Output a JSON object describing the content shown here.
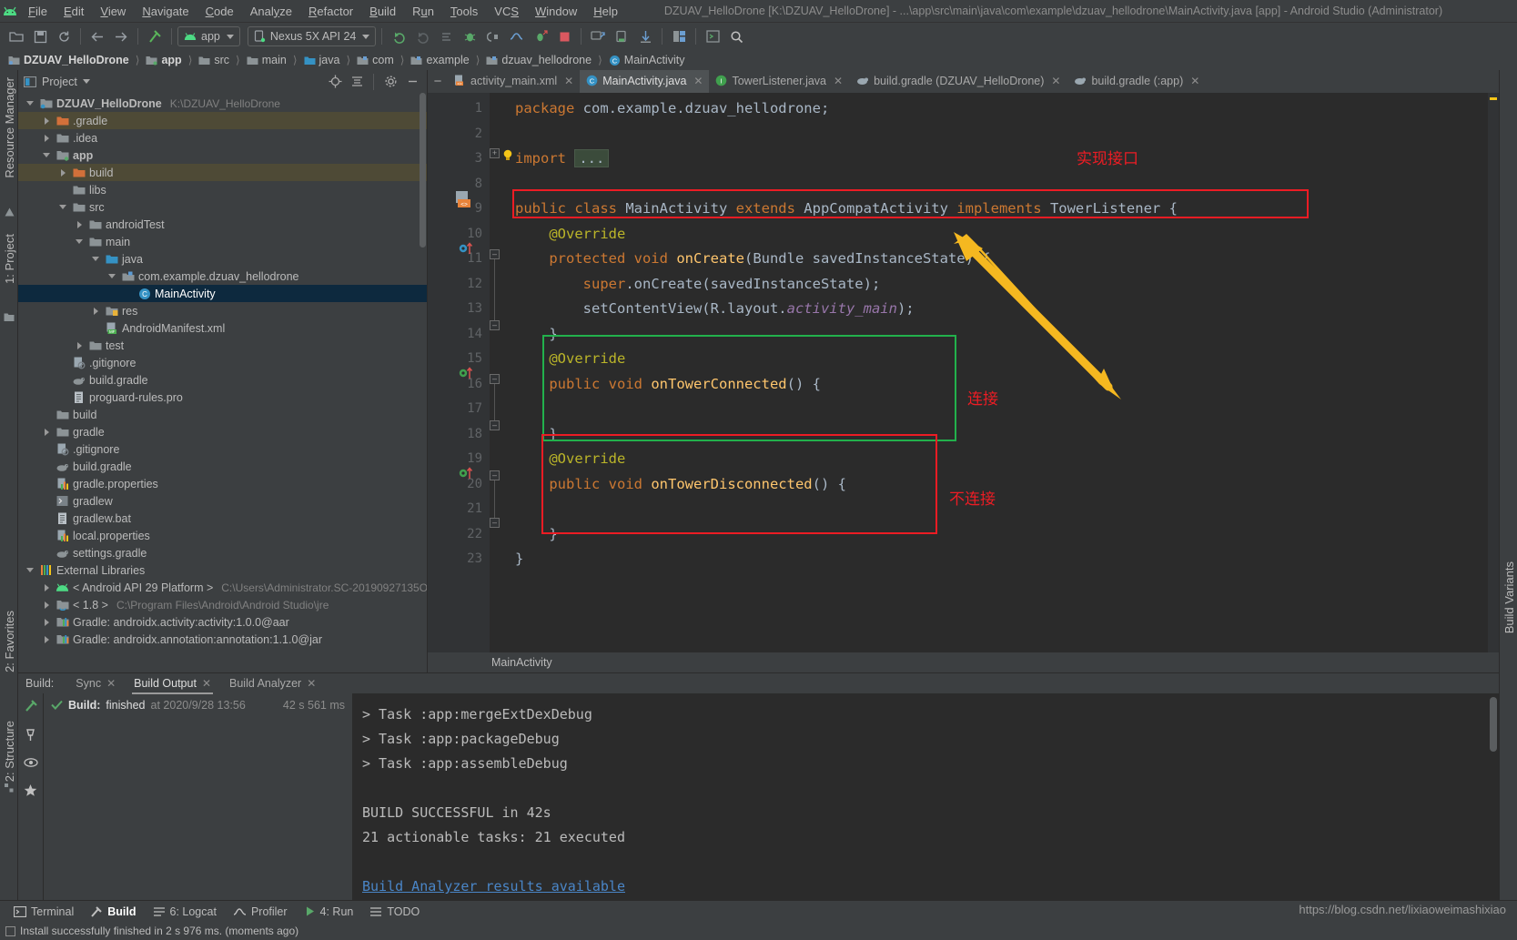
{
  "window": {
    "title": "DZUAV_HelloDrone [K:\\DZUAV_HelloDrone] - ...\\app\\src\\main\\java\\com\\example\\dzuav_hellodrone\\MainActivity.java [app] - Android Studio (Administrator)",
    "logo_icon": "android-logo-icon"
  },
  "menubar": [
    {
      "label": "File",
      "mnemonic": "F"
    },
    {
      "label": "Edit",
      "mnemonic": "E"
    },
    {
      "label": "View",
      "mnemonic": "V"
    },
    {
      "label": "Navigate",
      "mnemonic": "N"
    },
    {
      "label": "Code",
      "mnemonic": "C"
    },
    {
      "label": "Analyze",
      "mnemonic": "y"
    },
    {
      "label": "Refactor",
      "mnemonic": "R"
    },
    {
      "label": "Build",
      "mnemonic": "B"
    },
    {
      "label": "Run",
      "mnemonic": "u"
    },
    {
      "label": "Tools",
      "mnemonic": "T"
    },
    {
      "label": "VCS",
      "mnemonic": "S"
    },
    {
      "label": "Window",
      "mnemonic": "W"
    },
    {
      "label": "Help",
      "mnemonic": "H"
    }
  ],
  "toolbar": {
    "open_icon": "open-folder-icon",
    "save_icon": "save-icon",
    "sync_icon": "sync-icon",
    "back_icon": "arrow-left-icon",
    "forward_icon": "arrow-right-icon",
    "build_icon": "hammer-icon",
    "run_config": {
      "label": "app",
      "icon": "android-app-icon"
    },
    "device": {
      "label": "Nexus 5X API 24",
      "icon": "device-icon"
    },
    "run_icon": "run-icon",
    "rerun_icon": "rerun-icon",
    "apply_changes_icon": "apply-changes-icon",
    "debug_icon": "debug-icon",
    "attach_debugger_icon": "attach-debugger-icon",
    "profile_icon": "profiler-icon",
    "run_coverage_icon": "run-coverage-icon",
    "stop_icon": "stop-icon",
    "avd_manager_icon": "avd-manager-icon",
    "sdk_manager_icon": "sdk-manager-icon",
    "sync_gradle_icon": "sync-gradle-icon",
    "layout_inspector_icon": "layout-inspector-icon",
    "device_file_explorer_icon": "device-file-explorer-icon",
    "search_icon": "search-icon"
  },
  "breadcrumb": [
    {
      "label": "DZUAV_HelloDrone",
      "icon": "module-icon",
      "bold": true
    },
    {
      "label": "app",
      "icon": "app-module-icon",
      "bold": true
    },
    {
      "label": "src",
      "icon": "folder-icon",
      "bold": false
    },
    {
      "label": "main",
      "icon": "folder-icon",
      "bold": false
    },
    {
      "label": "java",
      "icon": "java-folder-icon",
      "bold": false
    },
    {
      "label": "com",
      "icon": "package-icon",
      "bold": false
    },
    {
      "label": "example",
      "icon": "package-icon",
      "bold": false
    },
    {
      "label": "dzuav_hellodrone",
      "icon": "package-icon",
      "bold": false
    },
    {
      "label": "MainActivity",
      "icon": "class-icon",
      "bold": false
    }
  ],
  "left_rail": [
    {
      "label": "Resource Manager",
      "icon": "resource-manager-icon"
    },
    {
      "label": "1: Project",
      "icon": "project-icon"
    }
  ],
  "left_rail_bottom": [
    {
      "label": "2: Favorites",
      "icon": "favorites-icon"
    },
    {
      "label": "2: Structure",
      "icon": "structure-icon"
    }
  ],
  "right_rail": [
    {
      "label": "Build Variants",
      "icon": "build-variants-icon"
    }
  ],
  "project_panel": {
    "title": "Project",
    "locate_icon": "locate-icon",
    "collapse_icon": "collapse-all-icon",
    "settings_icon": "gear-icon",
    "hide_icon": "hide-icon",
    "tree": [
      {
        "indent": 0,
        "arrow": "down",
        "icon": "module-icon",
        "label": "DZUAV_HelloDrone",
        "bold": true,
        "path": "K:\\DZUAV_HelloDrone",
        "state": "normal"
      },
      {
        "indent": 1,
        "arrow": "right",
        "icon": "folder-orange-icon",
        "label": ".gradle",
        "bold": false,
        "path": "",
        "state": "hl"
      },
      {
        "indent": 1,
        "arrow": "right",
        "icon": "folder-icon",
        "label": ".idea",
        "bold": false,
        "path": "",
        "state": "normal"
      },
      {
        "indent": 1,
        "arrow": "down",
        "icon": "app-module-icon",
        "label": "app",
        "bold": true,
        "path": "",
        "state": "normal"
      },
      {
        "indent": 2,
        "arrow": "right",
        "icon": "folder-orange-icon",
        "label": "build",
        "bold": false,
        "path": "",
        "state": "hl"
      },
      {
        "indent": 2,
        "arrow": "none",
        "icon": "folder-icon",
        "label": "libs",
        "bold": false,
        "path": "",
        "state": "normal"
      },
      {
        "indent": 2,
        "arrow": "down",
        "icon": "folder-icon",
        "label": "src",
        "bold": false,
        "path": "",
        "state": "normal"
      },
      {
        "indent": 3,
        "arrow": "right",
        "icon": "folder-icon",
        "label": "androidTest",
        "bold": false,
        "path": "",
        "state": "normal"
      },
      {
        "indent": 3,
        "arrow": "down",
        "icon": "folder-icon",
        "label": "main",
        "bold": false,
        "path": "",
        "state": "normal"
      },
      {
        "indent": 4,
        "arrow": "down",
        "icon": "java-folder-icon",
        "label": "java",
        "bold": false,
        "path": "",
        "state": "normal"
      },
      {
        "indent": 5,
        "arrow": "down",
        "icon": "package-icon",
        "label": "com.example.dzuav_hellodrone",
        "bold": false,
        "path": "",
        "state": "normal"
      },
      {
        "indent": 6,
        "arrow": "none",
        "icon": "class-icon",
        "label": "MainActivity",
        "bold": false,
        "path": "",
        "state": "sel"
      },
      {
        "indent": 4,
        "arrow": "right",
        "icon": "res-folder-icon",
        "label": "res",
        "bold": false,
        "path": "",
        "state": "normal"
      },
      {
        "indent": 4,
        "arrow": "none",
        "icon": "manifest-icon",
        "label": "AndroidManifest.xml",
        "bold": false,
        "path": "",
        "state": "normal"
      },
      {
        "indent": 3,
        "arrow": "right",
        "icon": "folder-icon",
        "label": "test",
        "bold": false,
        "path": "",
        "state": "normal"
      },
      {
        "indent": 2,
        "arrow": "none",
        "icon": "gitignore-icon",
        "label": ".gitignore",
        "bold": false,
        "path": "",
        "state": "normal"
      },
      {
        "indent": 2,
        "arrow": "none",
        "icon": "gradle-icon",
        "label": "build.gradle",
        "bold": false,
        "path": "",
        "state": "normal"
      },
      {
        "indent": 2,
        "arrow": "none",
        "icon": "text-file-icon",
        "label": "proguard-rules.pro",
        "bold": false,
        "path": "",
        "state": "normal"
      },
      {
        "indent": 1,
        "arrow": "none",
        "icon": "folder-icon",
        "label": "build",
        "bold": false,
        "path": "",
        "state": "normal"
      },
      {
        "indent": 1,
        "arrow": "right",
        "icon": "folder-icon",
        "label": "gradle",
        "bold": false,
        "path": "",
        "state": "normal"
      },
      {
        "indent": 1,
        "arrow": "none",
        "icon": "gitignore-icon",
        "label": ".gitignore",
        "bold": false,
        "path": "",
        "state": "normal"
      },
      {
        "indent": 1,
        "arrow": "none",
        "icon": "gradle-icon",
        "label": "build.gradle",
        "bold": false,
        "path": "",
        "state": "normal"
      },
      {
        "indent": 1,
        "arrow": "none",
        "icon": "properties-icon",
        "label": "gradle.properties",
        "bold": false,
        "path": "",
        "state": "normal"
      },
      {
        "indent": 1,
        "arrow": "none",
        "icon": "script-icon",
        "label": "gradlew",
        "bold": false,
        "path": "",
        "state": "normal"
      },
      {
        "indent": 1,
        "arrow": "none",
        "icon": "text-file-icon",
        "label": "gradlew.bat",
        "bold": false,
        "path": "",
        "state": "normal"
      },
      {
        "indent": 1,
        "arrow": "none",
        "icon": "properties-icon",
        "label": "local.properties",
        "bold": false,
        "path": "",
        "state": "normal"
      },
      {
        "indent": 1,
        "arrow": "none",
        "icon": "gradle-icon",
        "label": "settings.gradle",
        "bold": false,
        "path": "",
        "state": "normal"
      },
      {
        "indent": 0,
        "arrow": "down",
        "icon": "libraries-icon",
        "label": "External Libraries",
        "bold": false,
        "path": "",
        "state": "normal"
      },
      {
        "indent": 1,
        "arrow": "right",
        "icon": "android-sdk-icon",
        "label": "< Android API 29 Platform >",
        "bold": false,
        "path": "C:\\Users\\Administrator.SC-20190927135O\\",
        "state": "normal"
      },
      {
        "indent": 1,
        "arrow": "right",
        "icon": "jdk-icon",
        "label": "< 1.8 >",
        "bold": false,
        "path": "C:\\Program Files\\Android\\Android Studio\\jre",
        "state": "normal"
      },
      {
        "indent": 1,
        "arrow": "right",
        "icon": "library-icon",
        "label": "Gradle: androidx.activity:activity:1.0.0@aar",
        "bold": false,
        "path": "",
        "state": "normal"
      },
      {
        "indent": 1,
        "arrow": "right",
        "icon": "library-icon",
        "label": "Gradle: androidx.annotation:annotation:1.1.0@jar",
        "bold": false,
        "path": "",
        "state": "normal"
      }
    ]
  },
  "editor": {
    "tabs": [
      {
        "label": "activity_main.xml",
        "icon": "xml-layout-icon",
        "active": false,
        "closable": true
      },
      {
        "label": "MainActivity.java",
        "icon": "class-icon",
        "active": true,
        "closable": true
      },
      {
        "label": "TowerListener.java",
        "icon": "interface-icon",
        "active": false,
        "closable": true
      },
      {
        "label": "build.gradle (DZUAV_HelloDrone)",
        "icon": "gradle-icon",
        "active": false,
        "closable": true
      },
      {
        "label": "build.gradle (:app)",
        "icon": "gradle-icon",
        "active": false,
        "closable": true
      }
    ],
    "status_breadcrumb": "MainActivity",
    "line_numbers": [
      "1",
      "2",
      "3",
      "8",
      "9",
      "10",
      "11",
      "12",
      "13",
      "14",
      "15",
      "16",
      "17",
      "18",
      "19",
      "20",
      "21",
      "22",
      "23"
    ],
    "lines": [
      {
        "num": "1",
        "tokens": [
          {
            "t": "package",
            "c": "kw"
          },
          {
            "t": " com.example.dzuav_hellodrone;",
            "c": "plain"
          }
        ]
      },
      {
        "num": "2",
        "tokens": []
      },
      {
        "num": "3",
        "tokens": [
          {
            "t": "import",
            "c": "kw"
          },
          {
            "t": " ",
            "c": "plain"
          },
          {
            "t": "...",
            "c": "fold"
          }
        ]
      },
      {
        "num": "8",
        "tokens": []
      },
      {
        "num": "9",
        "tokens": [
          {
            "t": "public class",
            "c": "kw"
          },
          {
            "t": " MainActivity ",
            "c": "plain"
          },
          {
            "t": "extends",
            "c": "kw"
          },
          {
            "t": " AppCompatActivity ",
            "c": "plain"
          },
          {
            "t": "implements",
            "c": "kw"
          },
          {
            "t": " TowerListener {",
            "c": "plain"
          }
        ]
      },
      {
        "num": "10",
        "tokens": [
          {
            "t": "    @Override",
            "c": "ann"
          }
        ]
      },
      {
        "num": "11",
        "tokens": [
          {
            "t": "    protected void",
            "c": "kw"
          },
          {
            "t": " ",
            "c": "plain"
          },
          {
            "t": "onCreate",
            "c": "fn"
          },
          {
            "t": "(Bundle savedInstanceState) {",
            "c": "plain"
          }
        ]
      },
      {
        "num": "12",
        "tokens": [
          {
            "t": "        ",
            "c": "plain"
          },
          {
            "t": "super",
            "c": "kw"
          },
          {
            "t": ".onCreate(savedInstanceState);",
            "c": "plain"
          }
        ]
      },
      {
        "num": "13",
        "tokens": [
          {
            "t": "        setContentView(R.layout.",
            "c": "plain"
          },
          {
            "t": "activity_main",
            "c": "fld"
          },
          {
            "t": ");",
            "c": "plain"
          }
        ]
      },
      {
        "num": "14",
        "tokens": [
          {
            "t": "    }",
            "c": "plain"
          }
        ]
      },
      {
        "num": "15",
        "tokens": [
          {
            "t": "    @Override",
            "c": "ann"
          }
        ]
      },
      {
        "num": "16",
        "tokens": [
          {
            "t": "    public void",
            "c": "kw"
          },
          {
            "t": " ",
            "c": "plain"
          },
          {
            "t": "onTowerConnected",
            "c": "fn"
          },
          {
            "t": "() {",
            "c": "plain"
          }
        ]
      },
      {
        "num": "17",
        "tokens": []
      },
      {
        "num": "18",
        "tokens": [
          {
            "t": "    }",
            "c": "plain"
          }
        ]
      },
      {
        "num": "19",
        "tokens": [
          {
            "t": "    @Override",
            "c": "ann"
          }
        ]
      },
      {
        "num": "20",
        "tokens": [
          {
            "t": "    public void",
            "c": "kw"
          },
          {
            "t": " ",
            "c": "plain"
          },
          {
            "t": "onTowerDisconnected",
            "c": "fn"
          },
          {
            "t": "() {",
            "c": "plain"
          }
        ]
      },
      {
        "num": "21",
        "tokens": []
      },
      {
        "num": "22",
        "tokens": [
          {
            "t": "    }",
            "c": "plain"
          }
        ]
      },
      {
        "num": "23",
        "tokens": [
          {
            "t": "}",
            "c": "plain"
          }
        ]
      }
    ],
    "annotations": [
      {
        "text": "实现接口",
        "color": "#ed1c24",
        "name": "annotation-implement-interface"
      },
      {
        "text": "连接",
        "color": "#ed1c24",
        "name": "annotation-connected"
      },
      {
        "text": "不连接",
        "color": "#ed1c24",
        "name": "annotation-disconnected"
      }
    ],
    "highlight_boxes": [
      {
        "name": "red-box-class-declaration",
        "color": "#ec1c24"
      },
      {
        "name": "green-box-on-tower-connected",
        "color": "#22b14c"
      },
      {
        "name": "red-box-on-tower-disconnected",
        "color": "#ec1c24"
      }
    ],
    "colors": {
      "background": "#2b2b2b",
      "gutter": "#313335",
      "keyword": "#cc7832",
      "annotation": "#bbb529",
      "method": "#ffc66d",
      "field": "#9876aa",
      "text": "#a9b7c6",
      "line_number": "#606366"
    }
  },
  "build_panel": {
    "label": "Build:",
    "tabs": [
      {
        "label": "Sync",
        "active": false,
        "closable": true
      },
      {
        "label": "Build Output",
        "active": true,
        "closable": true
      },
      {
        "label": "Build Analyzer",
        "active": false,
        "closable": true
      }
    ],
    "tree": [
      {
        "icon": "success-check-icon",
        "label": "Build:",
        "detail": "finished",
        "at": "at 2020/9/28 13:56",
        "duration": "42 s 561 ms"
      }
    ],
    "console": [
      "> Task :app:mergeExtDexDebug",
      "> Task :app:packageDebug",
      "> Task :app:assembleDebug",
      "",
      "BUILD SUCCESSFUL in 42s",
      "21 actionable tasks: 21 executed",
      ""
    ],
    "console_link": "Build Analyzer results available",
    "rail_icons": [
      "build-run-icon",
      "pin-icon",
      "eye-icon",
      "star-icon"
    ]
  },
  "statusbar": {
    "items": [
      {
        "label": "Terminal",
        "icon": "terminal-icon",
        "active": false
      },
      {
        "label": "Build",
        "icon": "hammer-icon",
        "active": true
      },
      {
        "label": "6: Logcat",
        "icon": "logcat-icon",
        "active": false
      },
      {
        "label": "Profiler",
        "icon": "profiler-icon",
        "active": false
      },
      {
        "label": "4: Run",
        "icon": "run-icon",
        "active": false
      },
      {
        "label": "TODO",
        "icon": "todo-icon",
        "active": false
      }
    ],
    "message": "Install successfully finished in 2 s 976 ms. (moments ago)",
    "watermark": "https://blog.csdn.net/lixiaoweimashixiao"
  }
}
